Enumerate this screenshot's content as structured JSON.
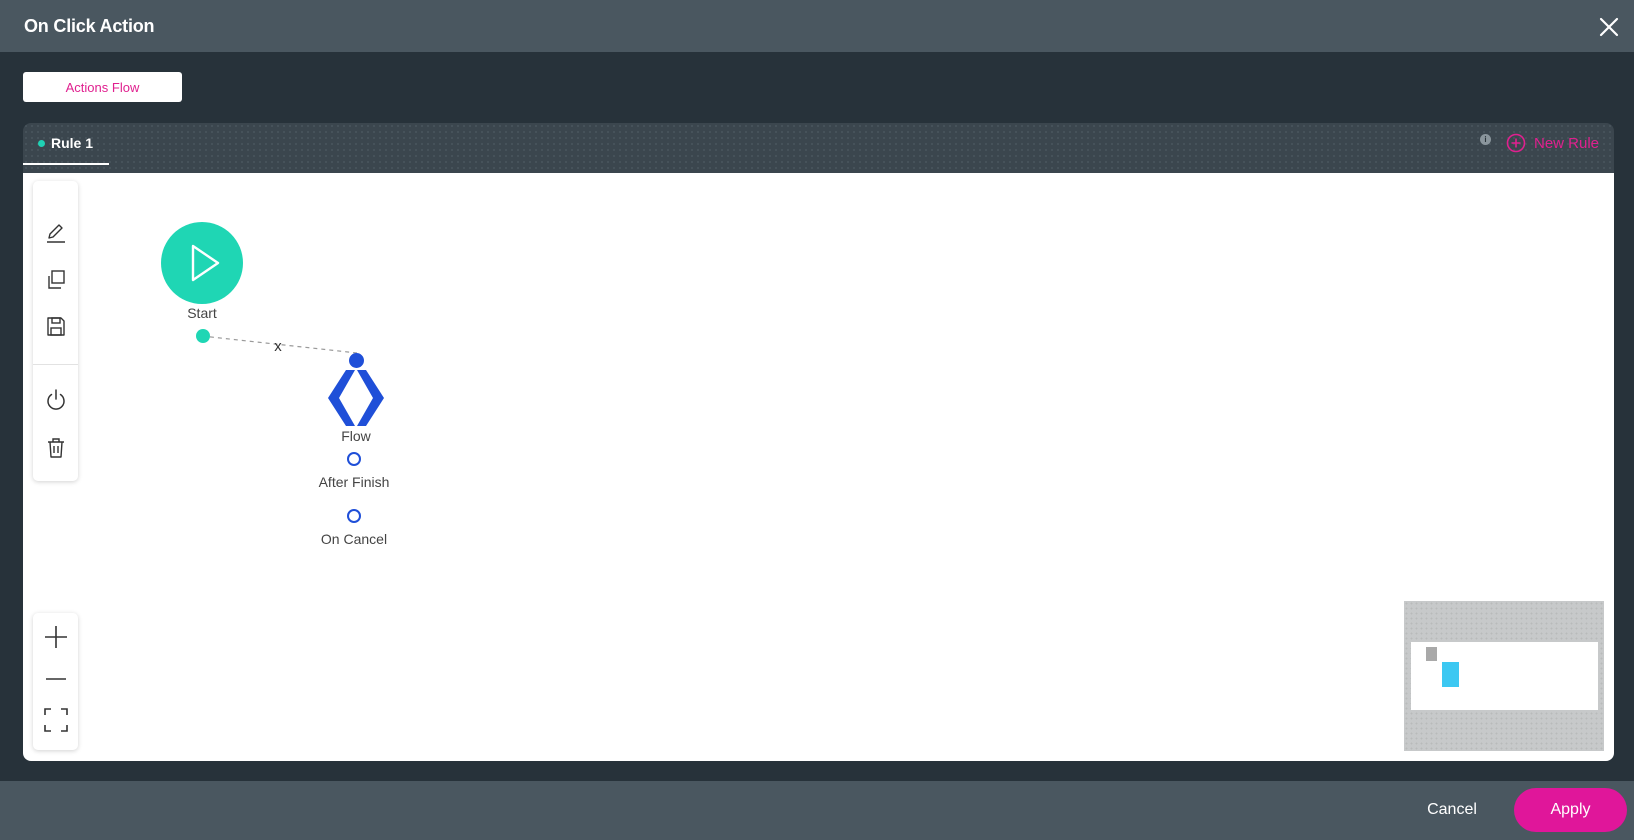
{
  "header": {
    "title": "On Click Action"
  },
  "tabs": {
    "actions_flow": "Actions Flow"
  },
  "rules": {
    "active": "Rule 1",
    "info": "i",
    "new_rule": "New Rule"
  },
  "nodes": {
    "start": {
      "label": "Start"
    },
    "edge_remove": "x",
    "flow": {
      "label": "Flow",
      "after_finish": "After Finish",
      "on_cancel": "On Cancel"
    }
  },
  "footer": {
    "cancel": "Cancel",
    "apply": "Apply"
  },
  "colors": {
    "accent": "#e0169a",
    "start": "#1fd6b4",
    "flow": "#1f4fd8"
  }
}
